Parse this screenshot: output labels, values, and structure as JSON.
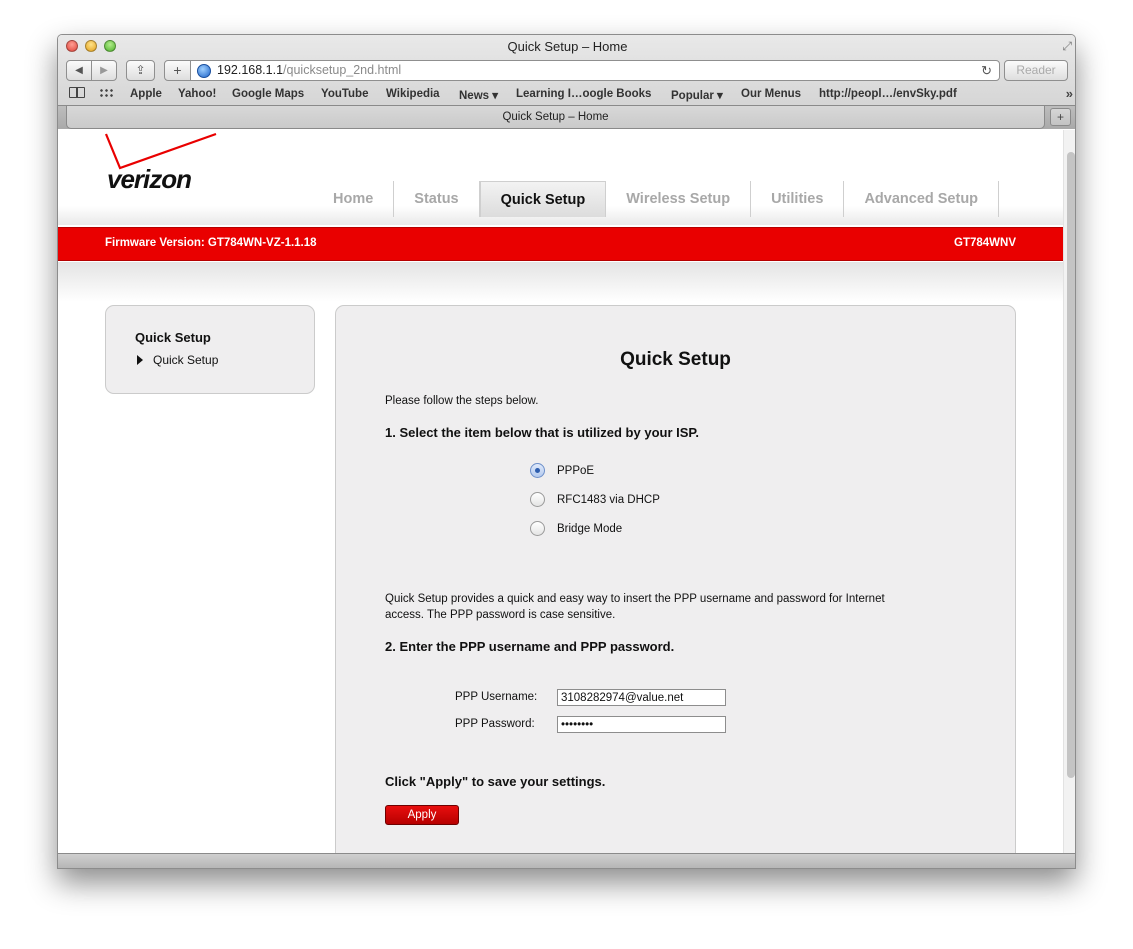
{
  "window": {
    "title": "Quick Setup – Home",
    "url_host": "192.168.1.1",
    "url_path": "/quicksetup_2nd.html",
    "reader_label": "Reader",
    "tab_title": "Quick Setup – Home"
  },
  "bookmarks": [
    "Apple",
    "Yahoo!",
    "Google Maps",
    "YouTube",
    "Wikipedia",
    "News ▾",
    "Learning I…oogle Books",
    "Popular ▾",
    "Our Menus",
    "http://peopl…/envSky.pdf"
  ],
  "header": {
    "logo_text": "verizon",
    "nav": [
      "Home",
      "Status",
      "Quick Setup",
      "Wireless Setup",
      "Utilities",
      "Advanced Setup"
    ],
    "active_nav": "Quick Setup"
  },
  "redbar": {
    "firmware": "Firmware Version: GT784WN-VZ-1.1.18",
    "model": "GT784WNV"
  },
  "sidebar": {
    "title": "Quick Setup",
    "item": "Quick Setup"
  },
  "main": {
    "title": "Quick Setup",
    "intro": "Please follow the steps below.",
    "step1": "1. Select the item below that is utilized by your ISP.",
    "options": [
      {
        "label": "PPPoE",
        "checked": true
      },
      {
        "label": "RFC1483 via DHCP",
        "checked": false
      },
      {
        "label": "Bridge Mode",
        "checked": false
      }
    ],
    "desc_line1": "Quick Setup provides a quick and easy way to insert the PPP username and password for Internet",
    "desc_line2": "access. The PPP password is case sensitive.",
    "step2": "2. Enter the PPP username and PPP password.",
    "username_label": "PPP Username:",
    "username_value": "3108282974@value.net",
    "password_label": "PPP Password:",
    "password_value": "••••••••",
    "apply_note": "Click \"Apply\" to save your settings.",
    "apply_label": "Apply"
  },
  "colors": {
    "brand_red": "#e90000",
    "panel_bg": "#efeeef"
  }
}
